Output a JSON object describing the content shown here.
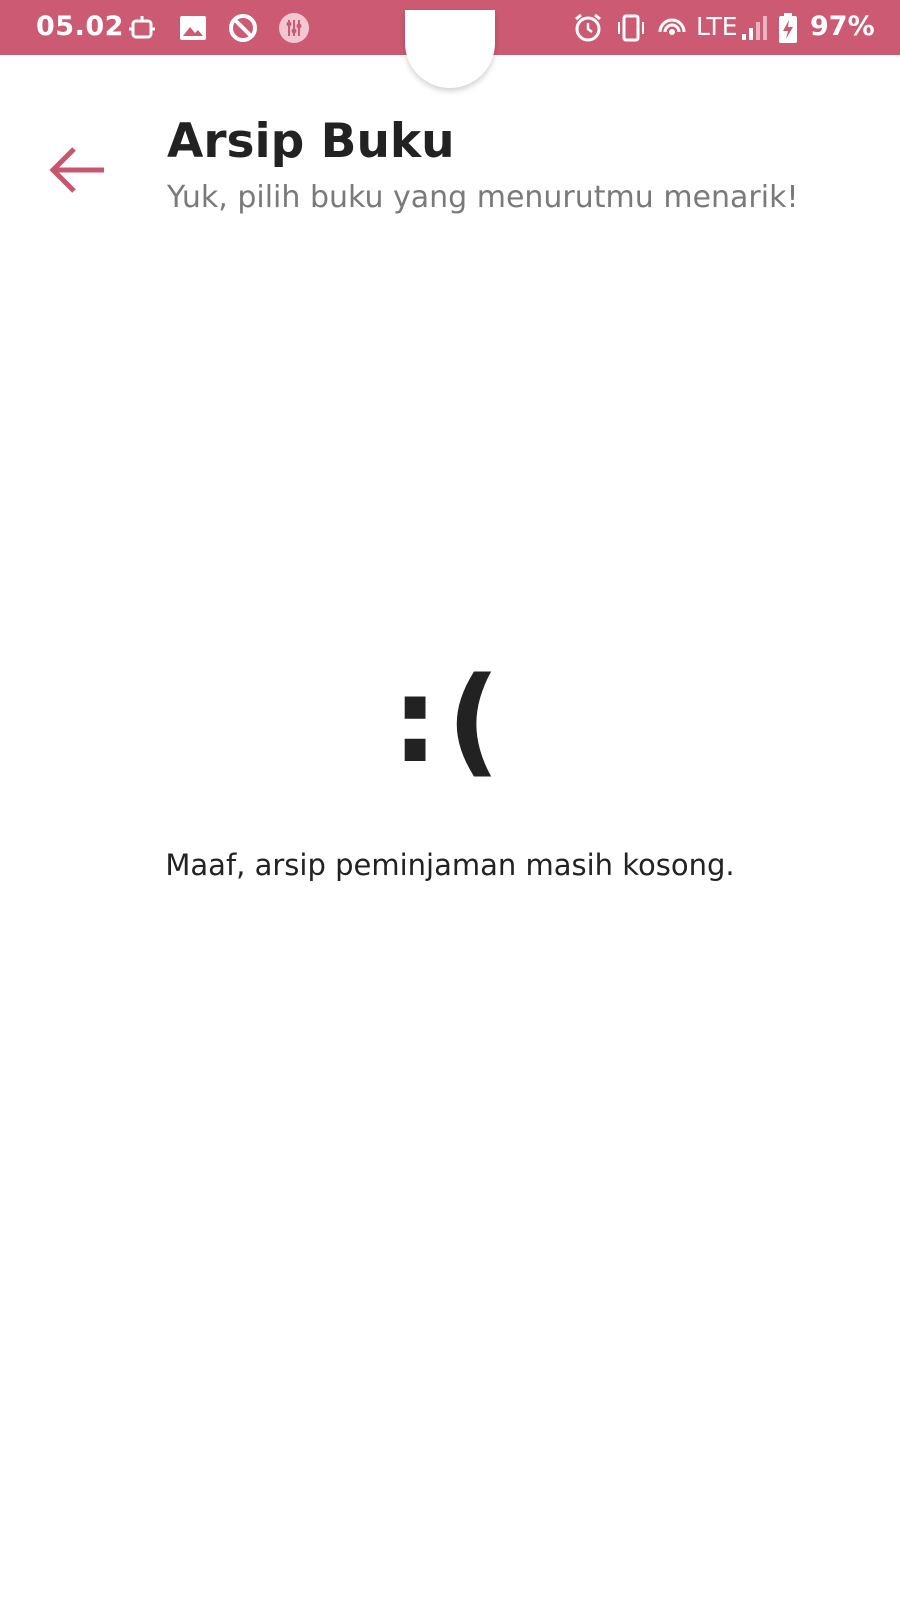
{
  "status_bar": {
    "time": "05.02",
    "network": "LTE",
    "battery": "97%",
    "background_color": "#cc5a72",
    "icons_left": [
      "android-debug-icon",
      "image-icon",
      "no-disturb-icon",
      "app-tuner-icon"
    ],
    "icons_right": [
      "alarm-icon",
      "vibrate-icon",
      "hotspot-icon",
      "signal-icon",
      "battery-charging-icon"
    ]
  },
  "header": {
    "title": "Arsip Buku",
    "subtitle": "Yuk, pilih buku yang menurutmu menarik!",
    "back_icon": "arrow-back-icon",
    "accent_color": "#c9566f"
  },
  "empty_state": {
    "emoticon": ":(",
    "message": "Maaf, arsip peminjaman masih kosong."
  }
}
